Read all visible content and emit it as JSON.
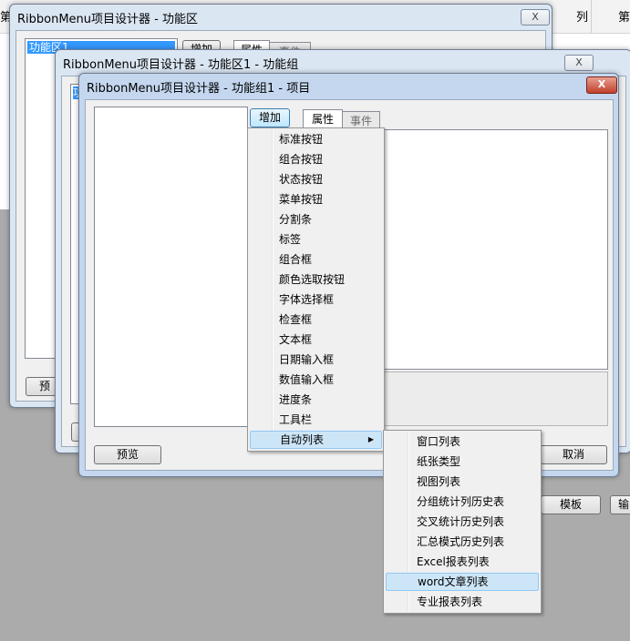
{
  "background_sheet": {
    "col_left": "第二",
    "col_mid": "列",
    "col_right": "第"
  },
  "win_back": {
    "title": "RibbonMenu项目设计器 - 功能区",
    "close_label": "X",
    "list_item": "功能区1",
    "add_button": "增加",
    "tab_props": "属性",
    "tab_events": "事件",
    "preview_button": "预"
  },
  "win_mid": {
    "title": "RibbonMenu项目设计器 - 功能区1 - 功能组",
    "close_label": "X",
    "list_item": "功",
    "template_button": "模板",
    "right_button": "输"
  },
  "win_front": {
    "title": "RibbonMenu项目设计器 - 功能组1 - 项目",
    "close_label": "X",
    "add_button": "增加",
    "tab_props": "属性",
    "tab_events": "事件",
    "preview_button": "预览",
    "cancel_button": "取消"
  },
  "menu": {
    "items": [
      "标准按钮",
      "组合按钮",
      "状态按钮",
      "菜单按钮",
      "分割条",
      "标签",
      "组合框",
      "颜色选取按钮",
      "字体选择框",
      "检查框",
      "文本框",
      "日期输入框",
      "数值输入框",
      "进度条",
      "工具栏",
      "自动列表"
    ],
    "submenu_arrow": "▶"
  },
  "submenu": {
    "items": [
      "窗口列表",
      "纸张类型",
      "视图列表",
      "分组统计列历史表",
      "交叉统计历史列表",
      "汇总模式历史列表",
      "Excel报表列表",
      "word文章列表",
      "专业报表列表"
    ]
  }
}
